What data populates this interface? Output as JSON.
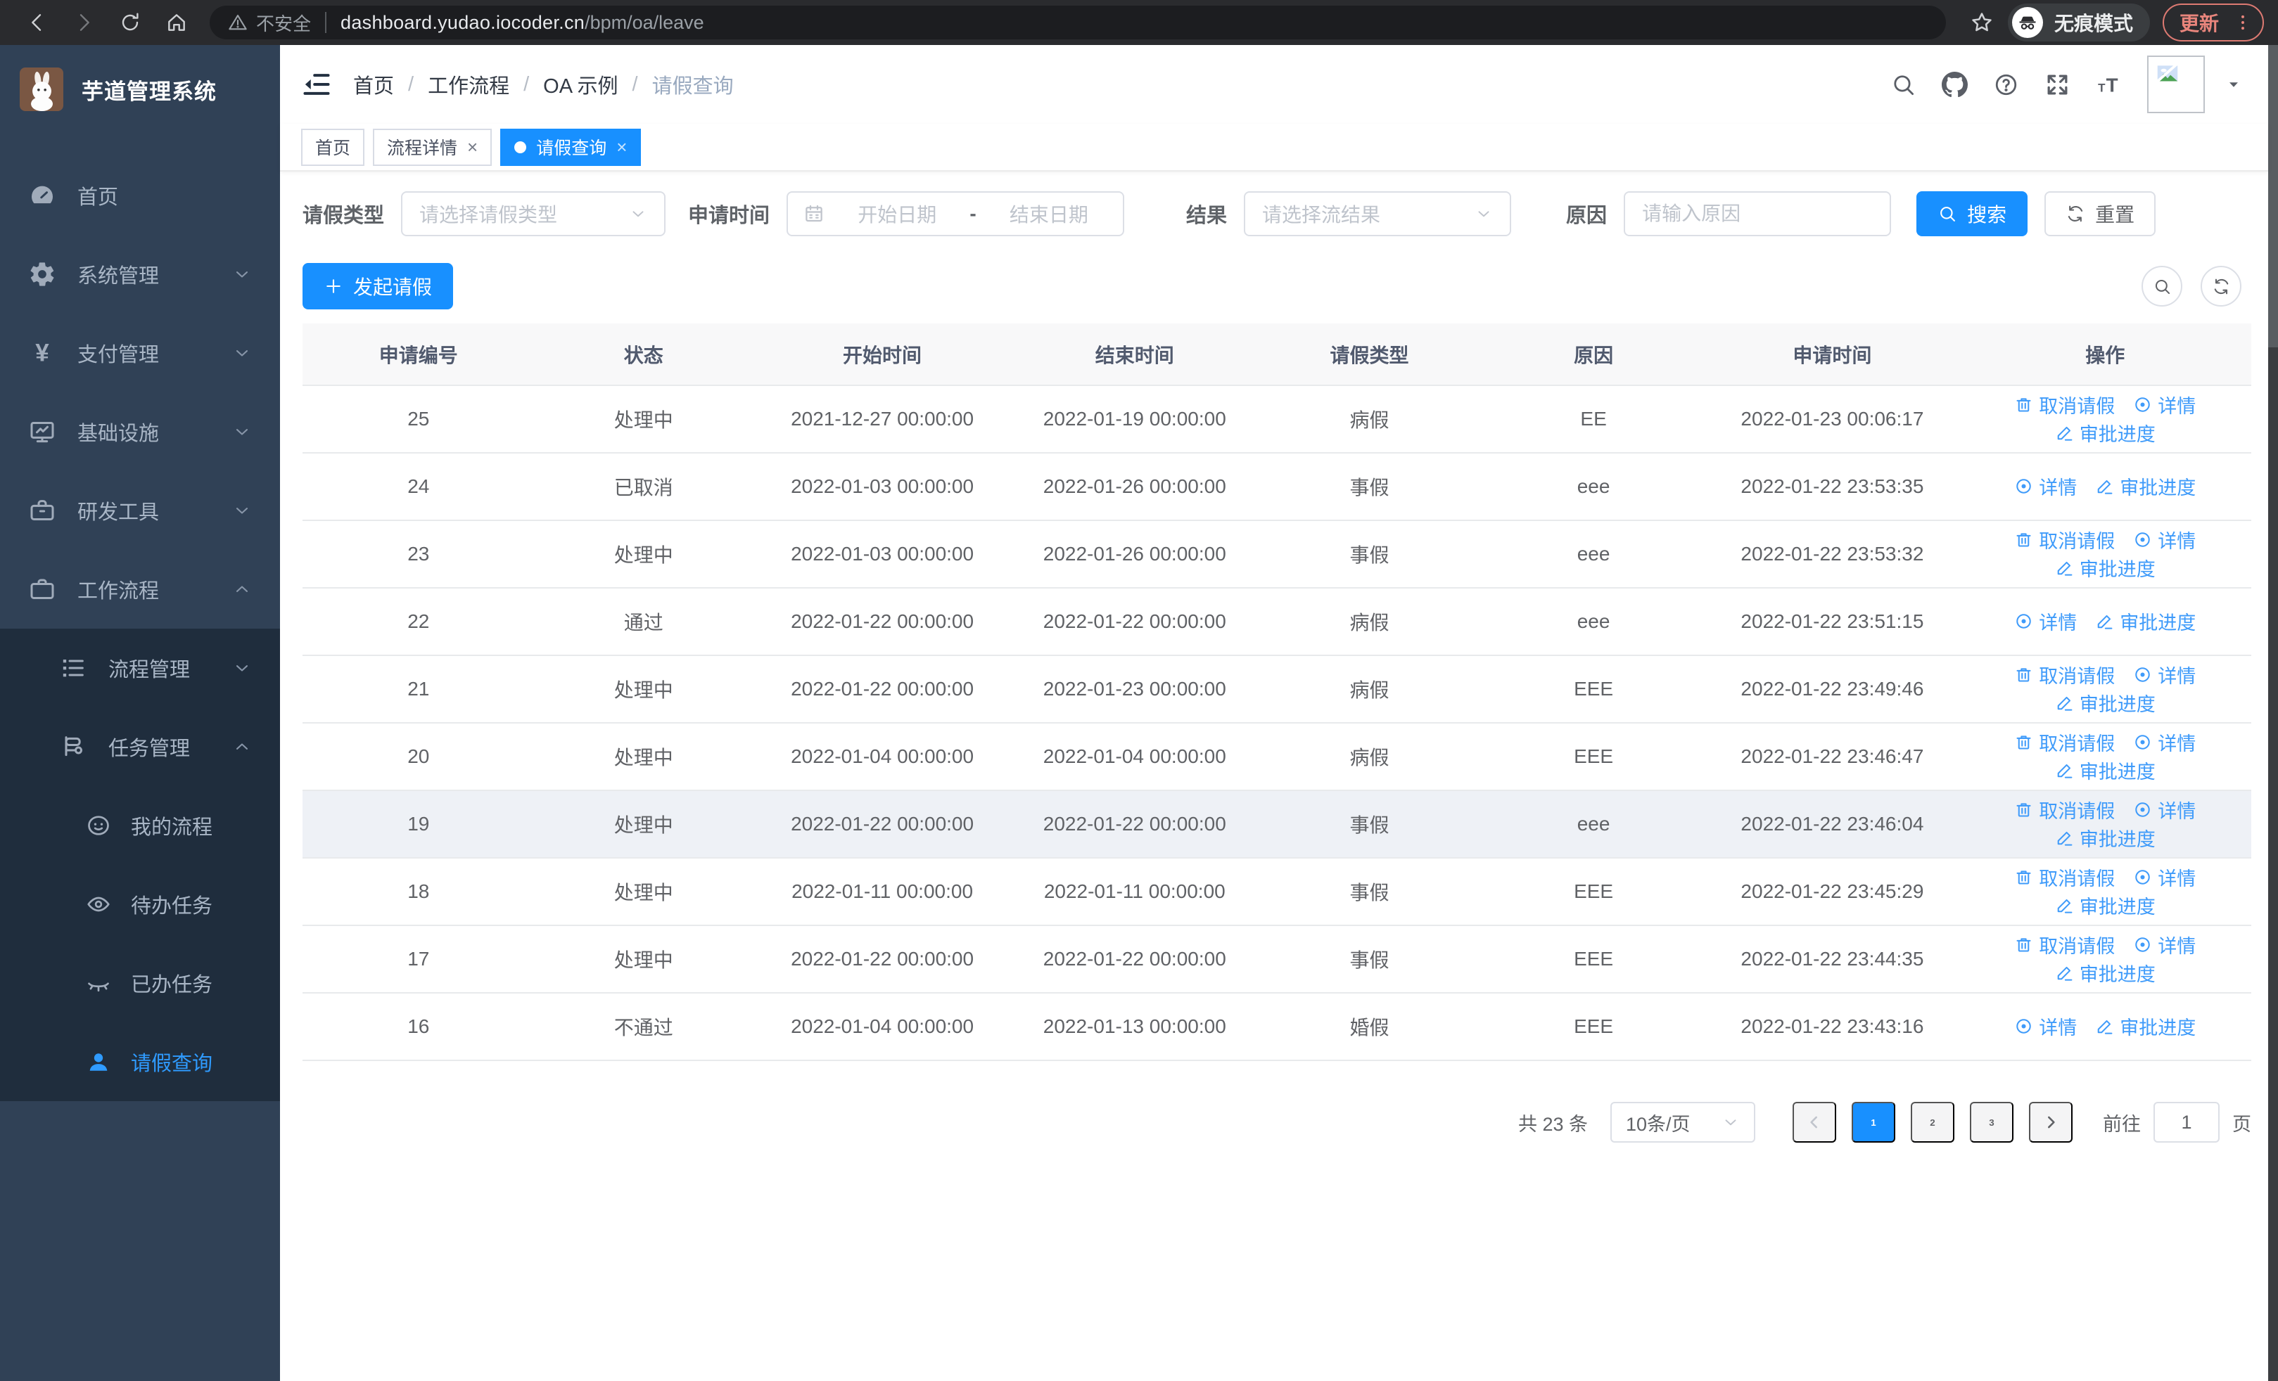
{
  "browser": {
    "nav_icons": [
      "back-icon",
      "forward-icon",
      "reload-icon",
      "home-icon"
    ],
    "security_label": "不安全",
    "url_host": "dashboard.yudao.iocoder.cn",
    "url_path": "/bpm/oa/leave",
    "incognito": {
      "icon": "incognito-icon",
      "label": "无痕模式"
    },
    "update": {
      "label": "更新",
      "menu_icon": "kebab-icon"
    }
  },
  "sidebar": {
    "logo_icon": "rabbit-logo",
    "title": "芋道管理系统",
    "menu": [
      {
        "label": "首页",
        "icon": "dashboard-icon",
        "level": 0
      },
      {
        "label": "系统管理",
        "icon": "gear-icon",
        "level": 0,
        "chevron": "down"
      },
      {
        "label": "支付管理",
        "icon": "yen-icon",
        "level": 0,
        "chevron": "down"
      },
      {
        "label": "基础设施",
        "icon": "monitor-icon",
        "level": 0,
        "chevron": "down"
      },
      {
        "label": "研发工具",
        "icon": "toolbox-icon",
        "level": 0,
        "chevron": "down"
      },
      {
        "label": "工作流程",
        "icon": "briefcase-icon",
        "level": 0,
        "chevron": "up"
      },
      {
        "label": "流程管理",
        "icon": "flow-icon",
        "level": 1,
        "chevron": "down",
        "block": true
      },
      {
        "label": "任务管理",
        "icon": "task-icon",
        "level": 1,
        "chevron": "up",
        "block": true
      },
      {
        "label": "我的流程",
        "icon": "face-icon",
        "level": 2,
        "block": true
      },
      {
        "label": "待办任务",
        "icon": "eye-open-icon",
        "level": 2,
        "block": true
      },
      {
        "label": "已办任务",
        "icon": "eye-close-icon",
        "level": 2,
        "block": true
      },
      {
        "label": "请假查询",
        "icon": "user-icon",
        "level": 2,
        "block": true,
        "active": true
      }
    ]
  },
  "navbar": {
    "fold_icon": "fold-icon",
    "breadcrumb": [
      "首页",
      "工作流程",
      "OA 示例",
      "请假查询"
    ],
    "icons": [
      "search-icon",
      "github-icon",
      "question-icon",
      "fullscreen-icon",
      "fontsize-icon"
    ],
    "avatar_icon": "broken-image-icon",
    "caret_icon": "caret-down-icon"
  },
  "tags": [
    {
      "label": "首页",
      "closable": false,
      "active": false
    },
    {
      "label": "流程详情",
      "closable": true,
      "active": false
    },
    {
      "label": "请假查询",
      "closable": true,
      "active": true
    }
  ],
  "filters": {
    "type": {
      "label": "请假类型",
      "placeholder": "请选择请假类型",
      "chevron_icon": "chevron-down-icon"
    },
    "time": {
      "label": "申请时间",
      "icon": "calendar-icon",
      "start_placeholder": "开始日期",
      "separator": "-",
      "end_placeholder": "结束日期"
    },
    "result": {
      "label": "结果",
      "placeholder": "请选择流结果",
      "chevron_icon": "chevron-down-icon"
    },
    "reason": {
      "label": "原因",
      "placeholder": "请输入原因"
    },
    "search_label": "搜索",
    "search_icon": "search-icon",
    "reset_label": "重置",
    "reset_icon": "refresh-icon"
  },
  "toolbar": {
    "create_label": "发起请假",
    "create_icon": "plus-icon",
    "icons": [
      "search-icon",
      "refresh-icon"
    ]
  },
  "table": {
    "columns": [
      "申请编号",
      "状态",
      "开始时间",
      "结束时间",
      "请假类型",
      "原因",
      "申请时间",
      "操作"
    ],
    "col_widths": [
      "11.9%",
      "11.2%",
      "13.3%",
      "12.6%",
      "11.5%",
      "11.5%",
      "13%",
      "15%"
    ],
    "actions": [
      {
        "key": "cancel",
        "label": "取消请假",
        "icon": "trash-icon"
      },
      {
        "key": "detail",
        "label": "详情",
        "icon": "view-icon"
      },
      {
        "key": "progress",
        "label": "审批进度",
        "icon": "edit-icon"
      }
    ],
    "rows": [
      {
        "id": "25",
        "status": "处理中",
        "start": "2021-12-27 00:00:00",
        "end": "2022-01-19 00:00:00",
        "type": "病假",
        "reason": "EE",
        "apply_time": "2022-01-23 00:06:17",
        "can_cancel": true
      },
      {
        "id": "24",
        "status": "已取消",
        "start": "2022-01-03 00:00:00",
        "end": "2022-01-26 00:00:00",
        "type": "事假",
        "reason": "eee",
        "apply_time": "2022-01-22 23:53:35",
        "can_cancel": false
      },
      {
        "id": "23",
        "status": "处理中",
        "start": "2022-01-03 00:00:00",
        "end": "2022-01-26 00:00:00",
        "type": "事假",
        "reason": "eee",
        "apply_time": "2022-01-22 23:53:32",
        "can_cancel": true
      },
      {
        "id": "22",
        "status": "通过",
        "start": "2022-01-22 00:00:00",
        "end": "2022-01-22 00:00:00",
        "type": "病假",
        "reason": "eee",
        "apply_time": "2022-01-22 23:51:15",
        "can_cancel": false
      },
      {
        "id": "21",
        "status": "处理中",
        "start": "2022-01-22 00:00:00",
        "end": "2022-01-23 00:00:00",
        "type": "病假",
        "reason": "EEE",
        "apply_time": "2022-01-22 23:49:46",
        "can_cancel": true
      },
      {
        "id": "20",
        "status": "处理中",
        "start": "2022-01-04 00:00:00",
        "end": "2022-01-04 00:00:00",
        "type": "病假",
        "reason": "EEE",
        "apply_time": "2022-01-22 23:46:47",
        "can_cancel": true
      },
      {
        "id": "19",
        "status": "处理中",
        "start": "2022-01-22 00:00:00",
        "end": "2022-01-22 00:00:00",
        "type": "事假",
        "reason": "eee",
        "apply_time": "2022-01-22 23:46:04",
        "can_cancel": true,
        "hovered": true
      },
      {
        "id": "18",
        "status": "处理中",
        "start": "2022-01-11 00:00:00",
        "end": "2022-01-11 00:00:00",
        "type": "事假",
        "reason": "EEE",
        "apply_time": "2022-01-22 23:45:29",
        "can_cancel": true
      },
      {
        "id": "17",
        "status": "处理中",
        "start": "2022-01-22 00:00:00",
        "end": "2022-01-22 00:00:00",
        "type": "事假",
        "reason": "EEE",
        "apply_time": "2022-01-22 23:44:35",
        "can_cancel": true
      },
      {
        "id": "16",
        "status": "不通过",
        "start": "2022-01-04 00:00:00",
        "end": "2022-01-13 00:00:00",
        "type": "婚假",
        "reason": "EEE",
        "apply_time": "2022-01-22 23:43:16",
        "can_cancel": false
      }
    ]
  },
  "pagination": {
    "total_label": "共 23 条",
    "page_size": "10条/页",
    "prev_icon": "chev-left-icon",
    "next_icon": "chev-right-icon",
    "pages": [
      "1",
      "2",
      "3"
    ],
    "active_page": "1",
    "jump_label": "前往",
    "jump_value": "1",
    "page_suffix": "页"
  },
  "colors": {
    "primary": "#1890ff",
    "link": "#3f9bfa",
    "sidebar_bg": "#304156",
    "submenu_bg": "#1f2d3d",
    "sidebar_active": "#2f9bff"
  }
}
